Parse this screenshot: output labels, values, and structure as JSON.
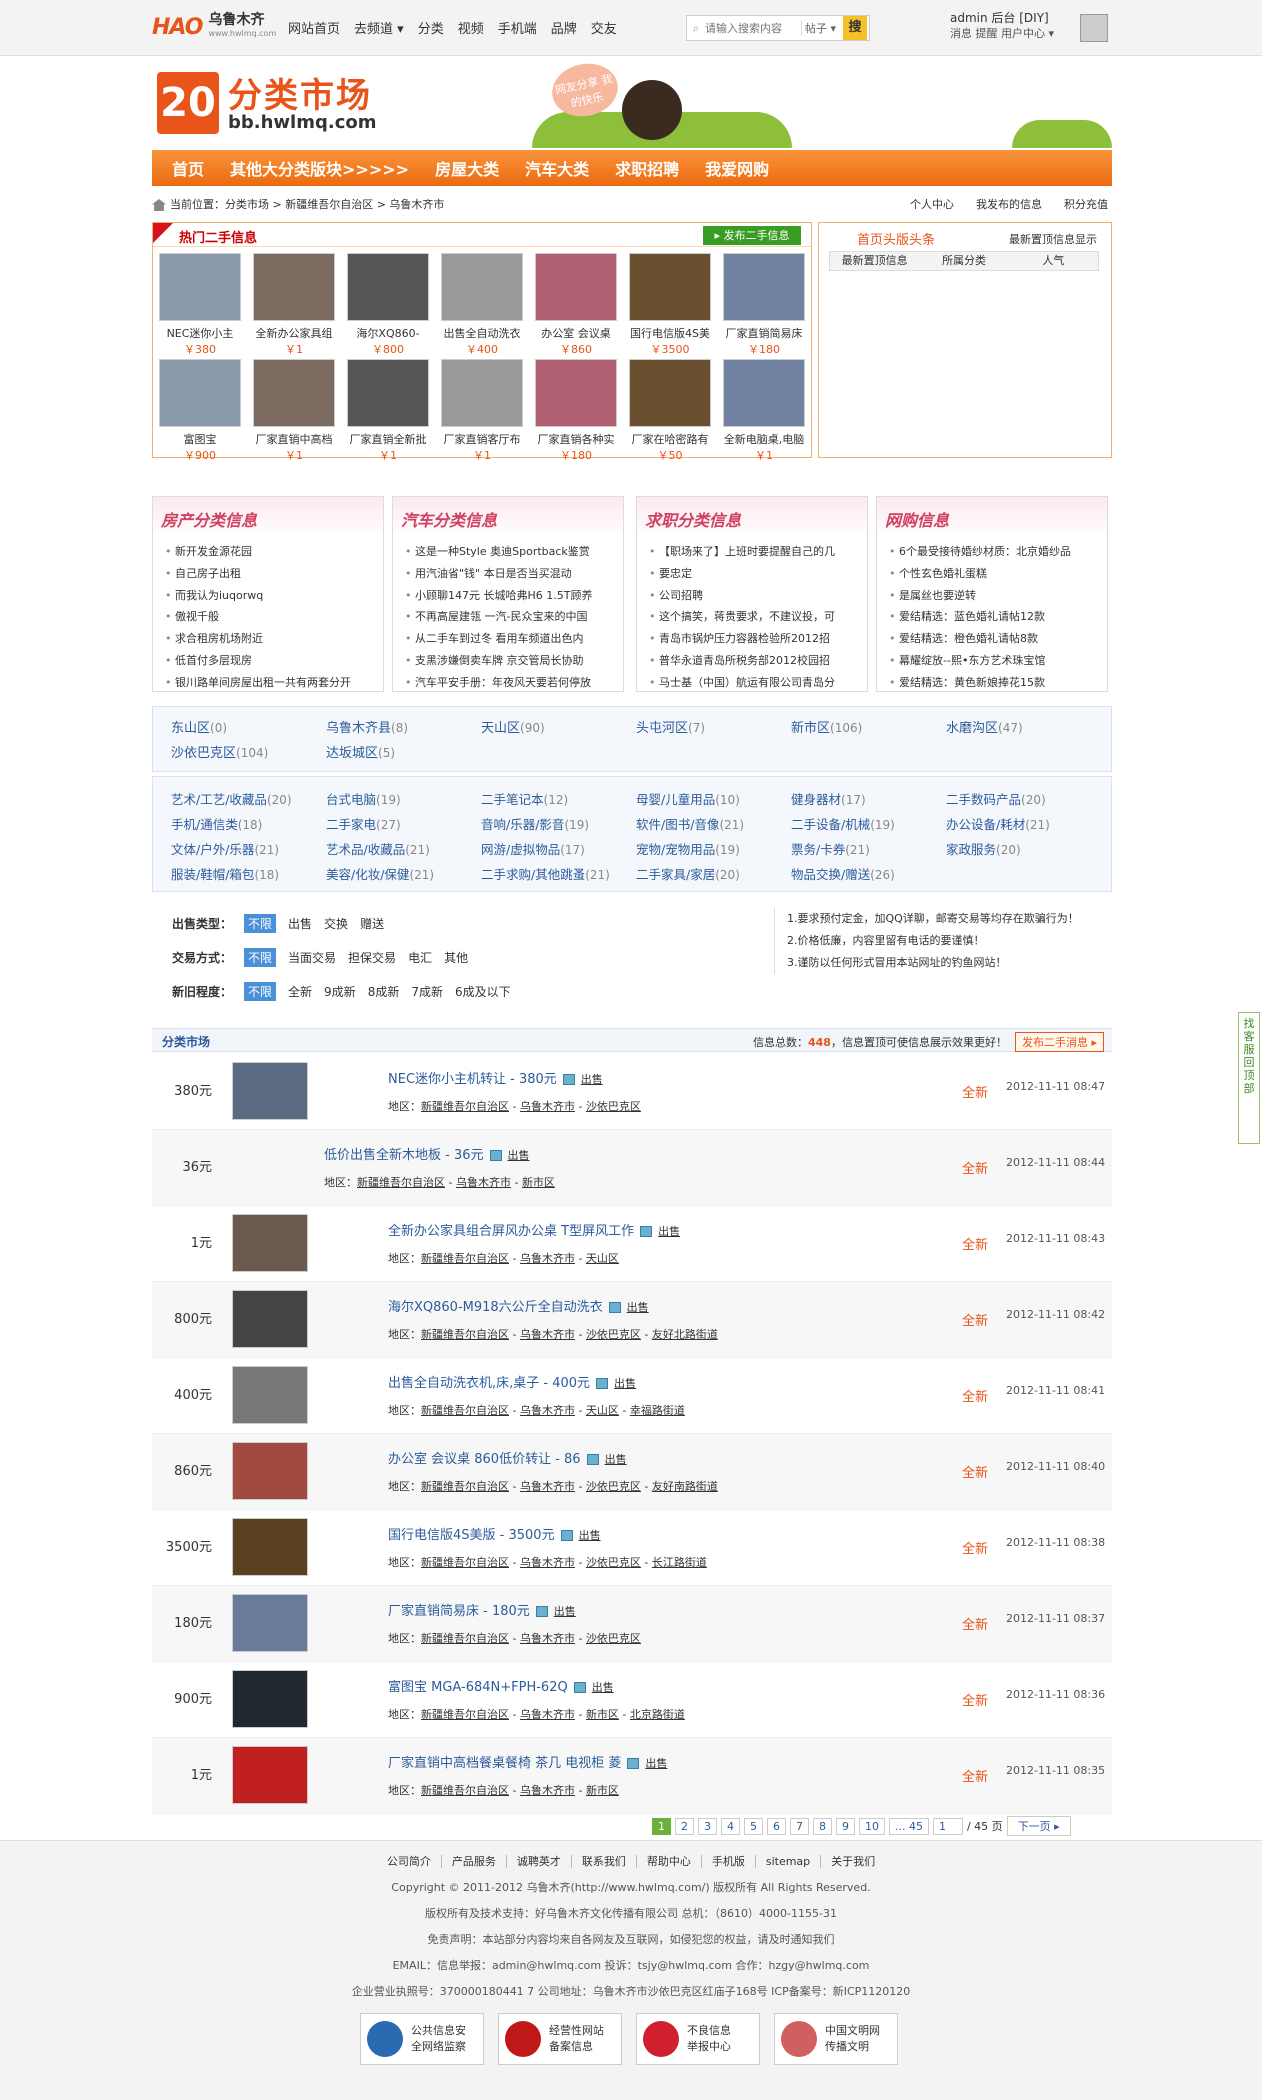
{
  "top": {
    "logo_mark": "HAO",
    "logo_name": "乌鲁木齐",
    "logo_sub": "www.hwlmq.com",
    "nav": [
      "网站首页",
      "去频道 ▾",
      "分类",
      "视频",
      "手机端",
      "品牌",
      "交友"
    ],
    "search_placeholder": "请输入搜索内容",
    "search_scope": "帖子 ▾",
    "search_button": "搜",
    "user_line1": "admin 后台 [DIY]",
    "user_line2": "消息  提醒  用户中心 ▾"
  },
  "banner": {
    "number": "20",
    "title": "分类市场",
    "domain": "bb.hwlmq.com",
    "bubble": "网友分享 我的快乐"
  },
  "mainnav": [
    "首页",
    "其他大分类版块>>>>>",
    "房屋大类",
    "汽车大类",
    "求职招聘",
    "我爱网购"
  ],
  "crumb": {
    "text": "当前位置：分类市场 > 新疆维吾尔自治区 > 乌鲁木齐市",
    "right": [
      "个人中心",
      "我发布的信息",
      "积分充值"
    ]
  },
  "hot": {
    "title": "热门二手信息",
    "publish": "▸ 发布二手信息",
    "row1": [
      {
        "t": "NEC迷你小主",
        "p": "￥380"
      },
      {
        "t": "全新办公家具组",
        "p": "￥1"
      },
      {
        "t": "海尔XQ860-",
        "p": "￥800"
      },
      {
        "t": "出售全自动洗衣",
        "p": "￥400"
      },
      {
        "t": "办公室 会议桌",
        "p": "￥860"
      },
      {
        "t": "国行电信版4S美",
        "p": "￥3500"
      },
      {
        "t": "厂家直销简易床",
        "p": "￥180"
      }
    ],
    "row2": [
      {
        "t": "富图宝",
        "p": "￥900"
      },
      {
        "t": "厂家直销中高档",
        "p": "￥1"
      },
      {
        "t": "厂家直销全新批",
        "p": "￥1"
      },
      {
        "t": "厂家直销客厅布",
        "p": "￥1"
      },
      {
        "t": "厂家直销各种实",
        "p": "￥180"
      },
      {
        "t": "厂家在哈密路有",
        "p": "￥50"
      },
      {
        "t": "全新电脑桌,电脑",
        "p": "￥1"
      }
    ]
  },
  "headline": {
    "title": "首页头版头条",
    "right": "最新置顶信息显示",
    "tabs": [
      "最新置顶信息",
      "所属分类",
      "人气"
    ]
  },
  "cards": [
    {
      "title": "房产分类信息",
      "items": [
        "新开发金源花园",
        "自己房子出租",
        "而我认为iuqorwq",
        "傲视千般",
        "求合租房机场附近",
        "低首付多层现房",
        "银川路单间房屋出租一共有两套分开"
      ]
    },
    {
      "title": "汽车分类信息",
      "items": [
        "这是一种Style 奥迪Sportback鉴赏",
        "用汽油省\"钱\" 本日是否当买混动",
        "小顾聊147元 长城哈弗H6 1.5T顾养",
        "不再高屋建瓴 一汽-民众宝来的中国",
        "从二手车到过冬 看用车频道出色内",
        "支黑涉嫌倒卖车牌 京交管局长协助",
        "汽车平安手册：年夜风天要若何停放"
      ]
    },
    {
      "title": "求职分类信息",
      "items": [
        "【职场来了】上班时要提醒自己的几",
        "要忠定",
        "公司招聘",
        "这个搞笑，蒋贵要求，不建议投，可",
        "青岛市锅炉压力容器检验所2012招",
        "普华永道青岛所税务部2012校园招",
        "马士基（中国）航运有限公司青岛分"
      ]
    },
    {
      "title": "网购信息",
      "items": [
        "6个最受接待婚纱材质：北京婚纱品",
        "个性玄色婚礼蛋糕",
        "是属丝也要逆转",
        "爱结精选：蓝色婚礼请帖12款",
        "爱结精选：橙色婚礼请帖8款",
        "幕耀绽放--熙•东方艺术珠宝馆",
        "爱结精选：黄色新娘捧花15款"
      ]
    }
  ],
  "regions": [
    {
      "n": "东山区",
      "c": "(0)"
    },
    {
      "n": "乌鲁木齐县",
      "c": "(8)"
    },
    {
      "n": "天山区",
      "c": "(90)"
    },
    {
      "n": "头屯河区",
      "c": "(7)"
    },
    {
      "n": "新市区",
      "c": "(106)"
    },
    {
      "n": "水磨沟区",
      "c": "(47)"
    },
    {
      "n": "沙依巴克区",
      "c": "(104)"
    },
    {
      "n": "达坂城区",
      "c": "(5)"
    }
  ],
  "cats": [
    {
      "n": "艺术/工艺/收藏品",
      "c": "(20)"
    },
    {
      "n": "台式电脑",
      "c": "(19)"
    },
    {
      "n": "二手笔记本",
      "c": "(12)"
    },
    {
      "n": "母婴/儿童用品",
      "c": "(10)"
    },
    {
      "n": "健身器材",
      "c": "(17)"
    },
    {
      "n": "二手数码产品",
      "c": "(20)"
    },
    {
      "n": "手机/通信类",
      "c": "(18)"
    },
    {
      "n": "二手家电",
      "c": "(27)"
    },
    {
      "n": "音响/乐器/影音",
      "c": "(19)"
    },
    {
      "n": "软件/图书/音像",
      "c": "(21)"
    },
    {
      "n": "二手设备/机械",
      "c": "(19)"
    },
    {
      "n": "办公设备/耗材",
      "c": "(21)"
    },
    {
      "n": "文体/户外/乐器",
      "c": "(21)"
    },
    {
      "n": "艺术品/收藏品",
      "c": "(21)"
    },
    {
      "n": "网游/虚拟物品",
      "c": "(17)"
    },
    {
      "n": "宠物/宠物用品",
      "c": "(19)"
    },
    {
      "n": "票务/卡券",
      "c": "(21)"
    },
    {
      "n": "家政服务",
      "c": "(20)"
    },
    {
      "n": "服装/鞋帽/箱包",
      "c": "(18)"
    },
    {
      "n": "美容/化妆/保健",
      "c": "(21)"
    },
    {
      "n": "二手求购/其他跳蚤",
      "c": "(21)"
    },
    {
      "n": "二手家具/家居",
      "c": "(20)"
    },
    {
      "n": "物品交换/赠送",
      "c": "(26)"
    }
  ],
  "filter": {
    "rows": [
      {
        "label": "出售类型：",
        "opts": [
          "不限",
          "出售",
          "交换",
          "赠送"
        ]
      },
      {
        "label": "交易方式：",
        "opts": [
          "不限",
          "当面交易",
          "担保交易",
          "电汇",
          "其他"
        ]
      },
      {
        "label": "新旧程度：",
        "opts": [
          "不限",
          "全新",
          "9成新",
          "8成新",
          "7成新",
          "6成及以下"
        ]
      }
    ],
    "notice": [
      "1.要求预付定金，加QQ详聊，邮寄交易等均存在欺骗行为！",
      "2.价格低廉，内容里留有电话的要谨慎！",
      "3.谨防以任何形式冒用本站网址的钓鱼网站！"
    ]
  },
  "list": {
    "title": "分类市场",
    "total_pre": "信息总数：",
    "total": "448",
    "total_post": "，信息置顶可使信息展示效果更好！",
    "publish": "发布二手消息 ▸",
    "report": "出售",
    "loc_label": "地区：",
    "rows": [
      {
        "price": "380元",
        "title": "NEC迷你小主机转让 - 380元",
        "loc": [
          "新疆维吾尔自治区",
          "乌鲁木齐市",
          "沙依巴克区"
        ],
        "cond": "全新",
        "date": "2012-11-11 08:47",
        "pic": true,
        "pc": "#5a6a80"
      },
      {
        "price": "36元",
        "title": "低价出售全新木地板 - 36元",
        "loc": [
          "新疆维吾尔自治区",
          "乌鲁木齐市",
          "新市区"
        ],
        "cond": "全新",
        "date": "2012-11-11 08:44",
        "pic": false
      },
      {
        "price": "1元",
        "title": "全新办公家具组合屏风办公桌 T型屏风工作",
        "loc": [
          "新疆维吾尔自治区",
          "乌鲁木齐市",
          "天山区"
        ],
        "cond": "全新",
        "date": "2012-11-11 08:43",
        "pic": true,
        "pc": "#6a5a50"
      },
      {
        "price": "800元",
        "title": "海尔XQ860-M918六公斤全自动洗衣",
        "loc": [
          "新疆维吾尔自治区",
          "乌鲁木齐市",
          "沙依巴克区",
          "友好北路街道"
        ],
        "cond": "全新",
        "date": "2012-11-11 08:42",
        "pic": true,
        "pc": "#444444"
      },
      {
        "price": "400元",
        "title": "出售全自动洗衣机,床,桌子 - 400元",
        "loc": [
          "新疆维吾尔自治区",
          "乌鲁木齐市",
          "天山区",
          "幸福路街道"
        ],
        "cond": "全新",
        "date": "2012-11-11 08:41",
        "pic": true,
        "pc": "#777777"
      },
      {
        "price": "860元",
        "title": "办公室 会议桌 860低价转让 - 86",
        "loc": [
          "新疆维吾尔自治区",
          "乌鲁木齐市",
          "沙依巴克区",
          "友好南路街道"
        ],
        "cond": "全新",
        "date": "2012-11-11 08:40",
        "pic": true,
        "pc": "#a04a40"
      },
      {
        "price": "3500元",
        "title": "国行电信版4S美版 - 3500元",
        "loc": [
          "新疆维吾尔自治区",
          "乌鲁木齐市",
          "沙依巴克区",
          "长江路街道"
        ],
        "cond": "全新",
        "date": "2012-11-11 08:38",
        "pic": true,
        "pc": "#5a4020"
      },
      {
        "price": "180元",
        "title": "厂家直销简易床 - 180元",
        "loc": [
          "新疆维吾尔自治区",
          "乌鲁木齐市",
          "沙依巴克区"
        ],
        "cond": "全新",
        "date": "2012-11-11 08:37",
        "pic": true,
        "pc": "#6a7a9a"
      },
      {
        "price": "900元",
        "title": "富图宝 MGA-684N+FPH-62Q",
        "loc": [
          "新疆维吾尔自治区",
          "乌鲁木齐市",
          "新市区",
          "北京路街道"
        ],
        "cond": "全新",
        "date": "2012-11-11 08:36",
        "pic": true,
        "pc": "#202830"
      },
      {
        "price": "1元",
        "title": "厂家直销中高档餐桌餐椅 茶几 电视柜 菱",
        "loc": [
          "新疆维吾尔自治区",
          "乌鲁木齐市",
          "新市区"
        ],
        "cond": "全新",
        "date": "2012-11-11 08:35",
        "pic": true,
        "pc": "#c02020"
      }
    ]
  },
  "pager": {
    "pages": [
      "1",
      "2",
      "3",
      "4",
      "5",
      "6",
      "7",
      "8",
      "9",
      "10",
      "... 45"
    ],
    "input": "1",
    "total": "/ 45 页",
    "next": "下一页 ▸"
  },
  "footer": {
    "links": [
      "公司简介",
      "产品服务",
      "诚聘英才",
      "联系我们",
      "帮助中心",
      "手机版",
      "sitemap",
      "关于我们"
    ],
    "lines": [
      "Copyright © 2011-2012 乌鲁木齐(http://www.hwlmq.com/) 版权所有 All Rights Reserved.",
      "版权所有及技术支持：好乌鲁木齐文化传播有限公司 总机：（8610）4000-1155-31",
      "免责声明：本站部分内容均来自各网友及互联网，如侵犯您的权益，请及时通知我们",
      "EMAIL：信息举报：admin@hwlmq.com 投诉：tsjy@hwlmq.com 合作：hzgy@hwlmq.com",
      "企业营业执照号：370000180441 7 公司地址：乌鲁木齐市沙依巴克区红庙子168号 ICP备案号：新ICP1120120"
    ],
    "badges": [
      {
        "l1": "公共信息安",
        "l2": "全网络监察",
        "c": "#2a6ab0"
      },
      {
        "l1": "经营性网站",
        "l2": "备案信息",
        "c": "#c01818"
      },
      {
        "l1": "不良信息",
        "l2": "举报中心",
        "c": "#d02030"
      },
      {
        "l1": "中国文明网",
        "l2": "传播文明",
        "c": "#d06060"
      }
    ]
  },
  "side": "找客服 回顶部"
}
